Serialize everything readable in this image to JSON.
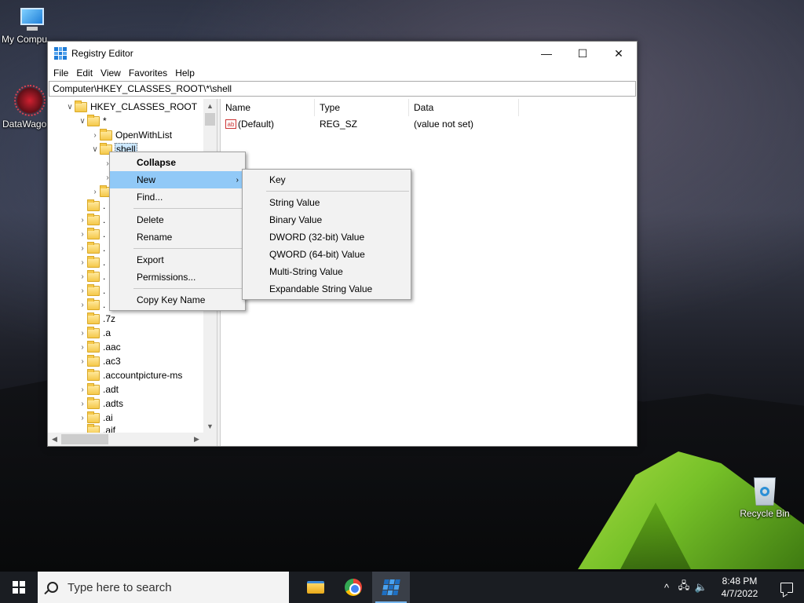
{
  "desktop": {
    "icons": [
      {
        "label": "My Compu",
        "icon": "computer-icon"
      },
      {
        "label": "DataWago",
        "icon": "datawagon-icon"
      },
      {
        "label": "Recycle Bin",
        "icon": "recycle-bin-icon"
      }
    ]
  },
  "window": {
    "title": "Registry Editor",
    "controls": {
      "minimize": "—",
      "maximize": "☐",
      "close": "✕"
    },
    "menu": [
      "File",
      "Edit",
      "View",
      "Favorites",
      "Help"
    ],
    "address": "Computer\\HKEY_CLASSES_ROOT\\*\\shell"
  },
  "tree": {
    "root": "HKEY_CLASSES_ROOT",
    "star": "*",
    "openwithlist": "OpenWithList",
    "shell": "shell",
    "partial": [
      ".",
      ".",
      ".",
      ".",
      ".",
      ".",
      ".",
      "."
    ],
    "items": [
      ".7z",
      ".a",
      ".aac",
      ".ac3",
      ".accountpicture-ms",
      ".adt",
      ".adts",
      ".ai",
      ".aif"
    ]
  },
  "list": {
    "headers": [
      "Name",
      "Type",
      "Data"
    ],
    "rows": [
      {
        "name": "(Default)",
        "type": "REG_SZ",
        "data": "(value not set)",
        "icon": "ab"
      }
    ]
  },
  "context_menu": {
    "collapse": "Collapse",
    "new": "New",
    "find": "Find...",
    "delete": "Delete",
    "rename": "Rename",
    "export": "Export",
    "permissions": "Permissions...",
    "copy_key_name": "Copy Key Name"
  },
  "new_submenu": {
    "key": "Key",
    "string_value": "String Value",
    "binary_value": "Binary Value",
    "dword": "DWORD (32-bit) Value",
    "qword": "QWORD (64-bit) Value",
    "multi_string": "Multi-String Value",
    "expandable_string": "Expandable String Value"
  },
  "taskbar": {
    "search_placeholder": "Type here to search",
    "time": "8:48 PM",
    "date": "4/7/2022",
    "tray": {
      "chevron": "^",
      "network": "🖧",
      "volume": "🔈"
    }
  },
  "colors": {
    "menu_highlight": "#91c9f7",
    "selection": "#cce8ff",
    "taskbar": "#1a1d22"
  }
}
